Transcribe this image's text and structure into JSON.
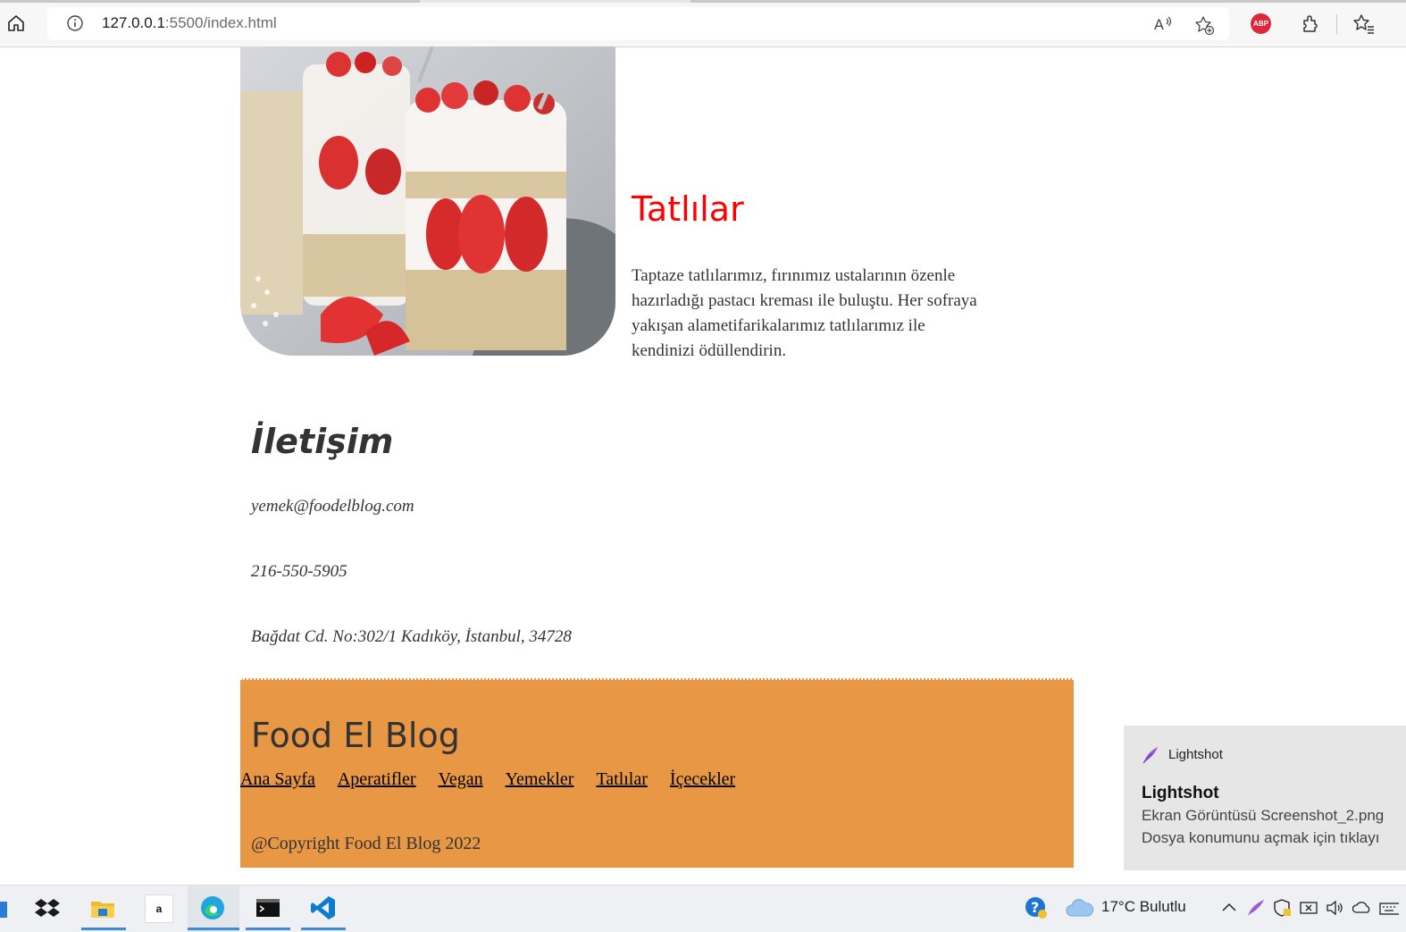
{
  "browser": {
    "url_host": "127.0.0.1",
    "url_rest": ":5500/index.html",
    "abp_label": "ABP"
  },
  "section": {
    "title": "Tatlılar",
    "description": "Taptaze tatlılarımız, fırınımız ustalarının özenle hazırladığı pastacı kreması ile buluştu. Her sofraya yakışan alametifarikalarımız tatlılarımız ile kendinizi ödüllendirin."
  },
  "contact": {
    "title": "İletişim",
    "email": "yemek@foodelblog.com",
    "phone": "216-550-5905",
    "address": "Bağdat Cd. No:302/1 Kadıköy, İstanbul, 34728"
  },
  "footer": {
    "brand": "Food El Blog",
    "nav": [
      "Ana Sayfa",
      "Aperatifler",
      "Vegan",
      "Yemekler",
      "Tatlılar",
      "İçecekler"
    ],
    "copyright": "@Copyright Food El Blog 2022",
    "bg_color": "#e89744"
  },
  "notification": {
    "app": "Lightshot",
    "title": "Lightshot",
    "line1": "Ekran Görüntüsü Screenshot_2.png",
    "line2": "Dosya konumunu açmak için tıklayı"
  },
  "taskbar": {
    "weather": "17°C  Bulutlu",
    "amazon_label": "a"
  }
}
